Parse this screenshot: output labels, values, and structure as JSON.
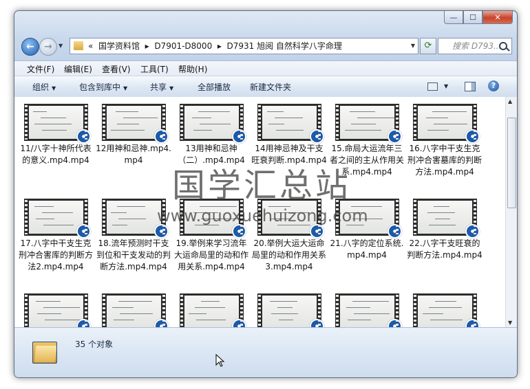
{
  "window": {
    "controls": [
      "—",
      "☐",
      "✕"
    ]
  },
  "nav": {
    "crumbs": [
      "«",
      "国学资料馆",
      "▸",
      "D7901-D8000",
      "▸",
      "D7931 旭阅 自然科学八字命理"
    ],
    "search_placeholder": "搜索 D793..."
  },
  "menu": [
    "文件(F)",
    "编辑(E)",
    "查看(V)",
    "工具(T)",
    "帮助(H)"
  ],
  "toolbar": {
    "organize": "组织",
    "include": "包含到库中",
    "share": "共享",
    "playall": "全部播放",
    "newfolder": "新建文件夹",
    "help": "?"
  },
  "files": [
    "11/八字十神所代表的意义.mp4.mp4",
    "12用神和忌神.mp4.mp4",
    "13用神和忌神（二）.mp4.mp4",
    "14用神忌神及干支旺衰判断.mp4.mp4",
    "15.命局大运流年三者之间的主从作用关系.mp4.mp4",
    "16.八字中干支生克刑冲合害墓库的判断方法.mp4.mp4",
    "17.八字中干支生克刑冲合害库的判断方法2.mp4.mp4",
    "18.流年预测时干支到位和干支发动的判断方法.mp4.mp4",
    "19.举例来学习流年大运命局里的动和作用关系.mp4.mp4",
    "20.举例大运大运命局里的动和作用关系3.mp4.mp4",
    "21.八字的定位系统.mp4.mp4",
    "22.八字干支旺衰的判断方法.mp4.mp4",
    "",
    "",
    "",
    "",
    "",
    ""
  ],
  "status": {
    "count": "35 个对象"
  },
  "watermark": {
    "cn": "国学汇总站",
    "url": "www.guoxuehuizong.com"
  }
}
